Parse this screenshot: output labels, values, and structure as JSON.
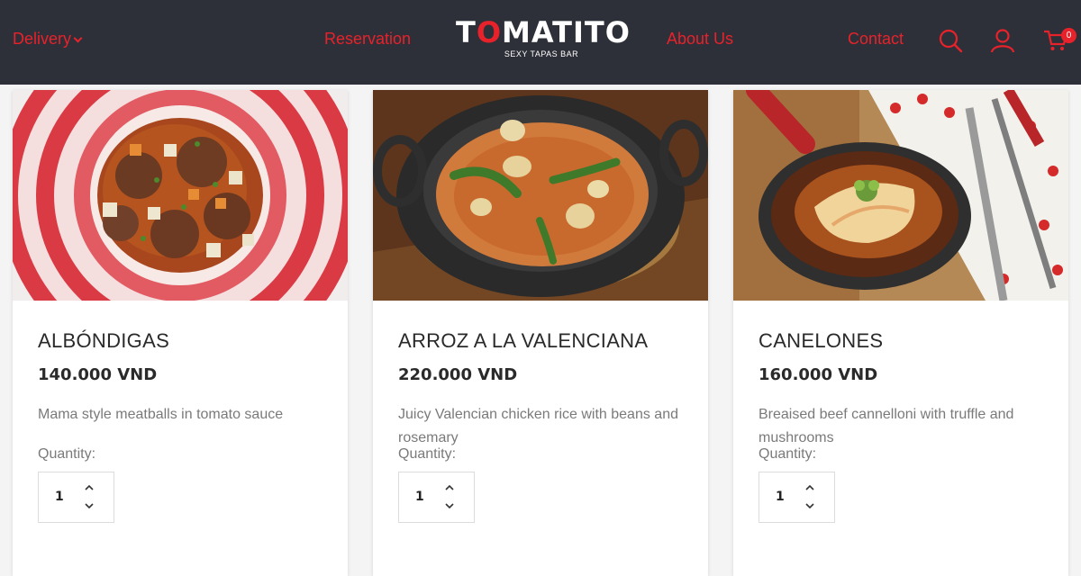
{
  "header": {
    "nav": {
      "delivery": "Delivery",
      "reservation": "Reservation",
      "about": "About Us",
      "contact": "Contact"
    },
    "logo": {
      "title_pre": "T",
      "title_o": "O",
      "title_post": "MATITO",
      "subtitle": "SEXY TAPAS BAR"
    },
    "cart_count": "0",
    "icons": [
      "search-icon",
      "user-icon",
      "cart-icon"
    ],
    "accent_color": "#e8222b",
    "background_color": "#2d3038"
  },
  "products": [
    {
      "name": "ALBÓNDIGAS",
      "price": "140.000 VND",
      "description": "Mama style meatballs in tomato sauce",
      "quantity_label": "Quantity:",
      "quantity": "1"
    },
    {
      "name": "ARROZ A LA VALENCIANA",
      "price": "220.000 VND",
      "description": "Juicy Valencian chicken rice with beans and rosemary",
      "quantity_label": "Quantity:",
      "quantity": "1"
    },
    {
      "name": "CANELONES",
      "price": "160.000 VND",
      "description": "Breaised beef cannelloni with truffle and mushrooms",
      "quantity_label": "Quantity:",
      "quantity": "1"
    }
  ]
}
